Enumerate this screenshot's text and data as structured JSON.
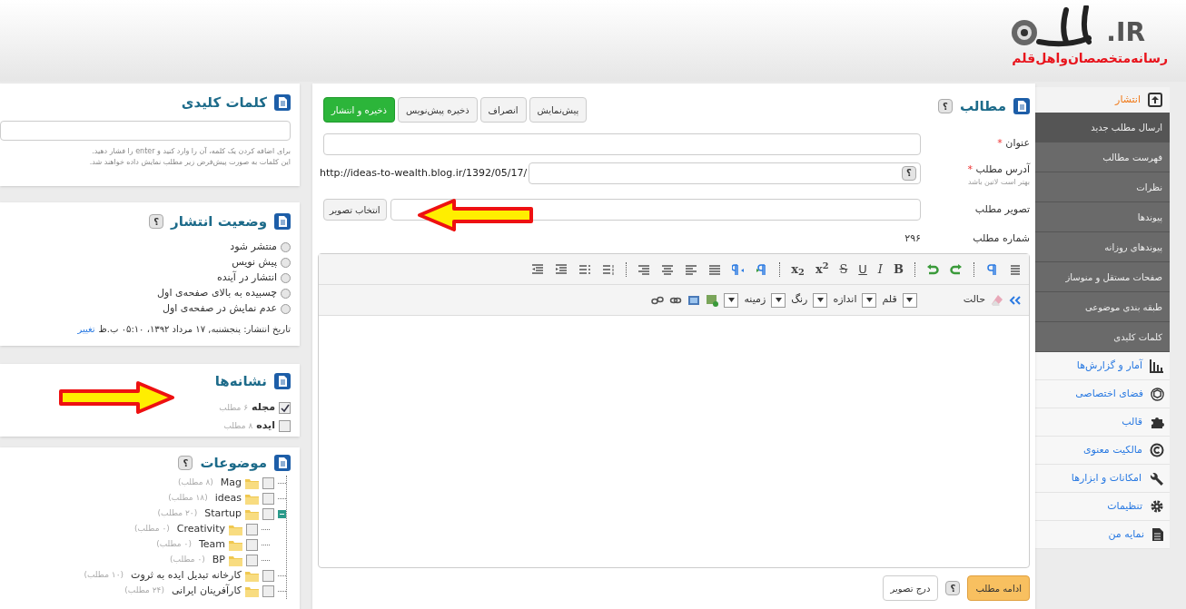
{
  "header": {
    "logo_suffix": ".IR",
    "tagline": "رسانه‌متخصصان‌واهل‌قلم"
  },
  "sidebar": {
    "section": {
      "label": "انتشار",
      "selected": true,
      "items": [
        {
          "label": "ارسال مطلب جدید",
          "selected": true
        },
        {
          "label": "فهرست مطالب",
          "selected": false
        },
        {
          "label": "نظرات",
          "selected": false
        },
        {
          "label": "پیوندها",
          "selected": false
        },
        {
          "label": "پیوندهای روزانه",
          "selected": false
        },
        {
          "label": "صفحات مستقل و منوساز",
          "selected": false
        },
        {
          "label": "طبقه بندی موضوعی",
          "selected": false
        },
        {
          "label": "کلمات کلیدی",
          "selected": false
        }
      ]
    },
    "items": [
      {
        "label": "آمار و گزارش‌ها"
      },
      {
        "label": "فضای اختصاصی"
      },
      {
        "label": "قالب"
      },
      {
        "label": "مالکیت معنوی"
      },
      {
        "label": "امکانات و ابزارها"
      },
      {
        "label": "تنظیمات"
      },
      {
        "label": "نمایه من"
      }
    ]
  },
  "post": {
    "title": "مطالب",
    "help": "؟",
    "buttons": [
      {
        "label": "پیش‌نمایش",
        "kind": "plain"
      },
      {
        "label": "انصراف",
        "kind": "plain"
      },
      {
        "label": "ذخیره پیش‌نویس",
        "kind": "plain"
      },
      {
        "label": "ذخیره و انتشار",
        "kind": "primary"
      }
    ],
    "title_field": {
      "label": "عنوان",
      "required": "*"
    },
    "url_field": {
      "label": "آدرس مطلب",
      "required": "*",
      "hint": "بهتر است لاتین باشد",
      "help": "؟",
      "prefix": "http://ideas-to-wealth.blog.ir/1392/05/17/"
    },
    "image_field": {
      "label": "تصویر مطلب",
      "button": "انتخاب تصویر"
    },
    "number": {
      "label": "شماره مطلب",
      "value": "۲۹۶"
    },
    "editor": {
      "format_buttons": [
        {
          "label": "B",
          "kind": "bold"
        },
        {
          "label": "I",
          "kind": "italic"
        },
        {
          "label": "U",
          "kind": "underline"
        },
        {
          "label": "S",
          "kind": "strike"
        },
        {
          "label": "x$^{2}$",
          "kind": "sup"
        },
        {
          "label": "x$_{2}$",
          "kind": "sub"
        }
      ],
      "selects": [
        {
          "label": "حالت"
        },
        {
          "label": "قلم"
        },
        {
          "label": "اندازه"
        },
        {
          "label": "رنگ"
        },
        {
          "label": "زمینه"
        }
      ]
    },
    "footer": {
      "more_button": "ادامه مطلب",
      "help": "؟",
      "insert_image_button": "درج تصویر"
    }
  },
  "keywords": {
    "title": "کلمات کلیدی",
    "hint": "برای اضافه کردن یک کلمه، آن را وارد کنید و enter را فشار دهید.\nاین کلمات به صورت پیش‌فرض زیر مطلب نمایش داده خواهند شد."
  },
  "publish_status": {
    "title": "وضعیت انتشار",
    "help": "؟",
    "options": [
      {
        "label": "منتشر شود",
        "selected": false
      },
      {
        "label": "پیش نویس",
        "selected": false
      },
      {
        "label": "انتشار در آینده",
        "selected": false
      },
      {
        "label": "چسبیده به بالای صفحه‌ی اول",
        "selected": false
      },
      {
        "label": "عدم نمایش در صفحه‌ی اول",
        "selected": false
      }
    ],
    "date": "تاریخ انتشار: پنجشنبه, ۱۷ مرداد ۱۳۹۲، ۰۵:۱۰ ب.ظ",
    "change_link": "تغییر"
  },
  "tags": {
    "title": "نشانه‌ها",
    "items": [
      {
        "label": "مجله",
        "count": "۶ مطلب",
        "checked": true
      },
      {
        "label": "ایده",
        "count": "۸ مطلب",
        "checked": false
      }
    ]
  },
  "categories": {
    "title": "موضوعات",
    "help": "؟",
    "items": [
      {
        "label": "Mag",
        "count": "(۸ مطلب)",
        "checked": false
      },
      {
        "label": "ideas",
        "count": "(۱۸ مطلب)",
        "checked": false
      },
      {
        "label": "Startup",
        "count": "(۲۰ مطلب)",
        "checked": false,
        "expanded": true,
        "children": [
          {
            "label": "Creativity",
            "count": "(۰ مطلب)",
            "checked": false
          },
          {
            "label": "Team",
            "count": "(۰ مطلب)",
            "checked": false
          },
          {
            "label": "BP",
            "count": "(۰ مطلب)",
            "checked": false
          }
        ]
      },
      {
        "label": "کارخانه تبدیل ایده به ثروت",
        "count": "(۱۰ مطلب)",
        "checked": false
      },
      {
        "label": "کارآفرینان ایرانی",
        "count": "(۲۴ مطلب)",
        "checked": false
      }
    ]
  }
}
